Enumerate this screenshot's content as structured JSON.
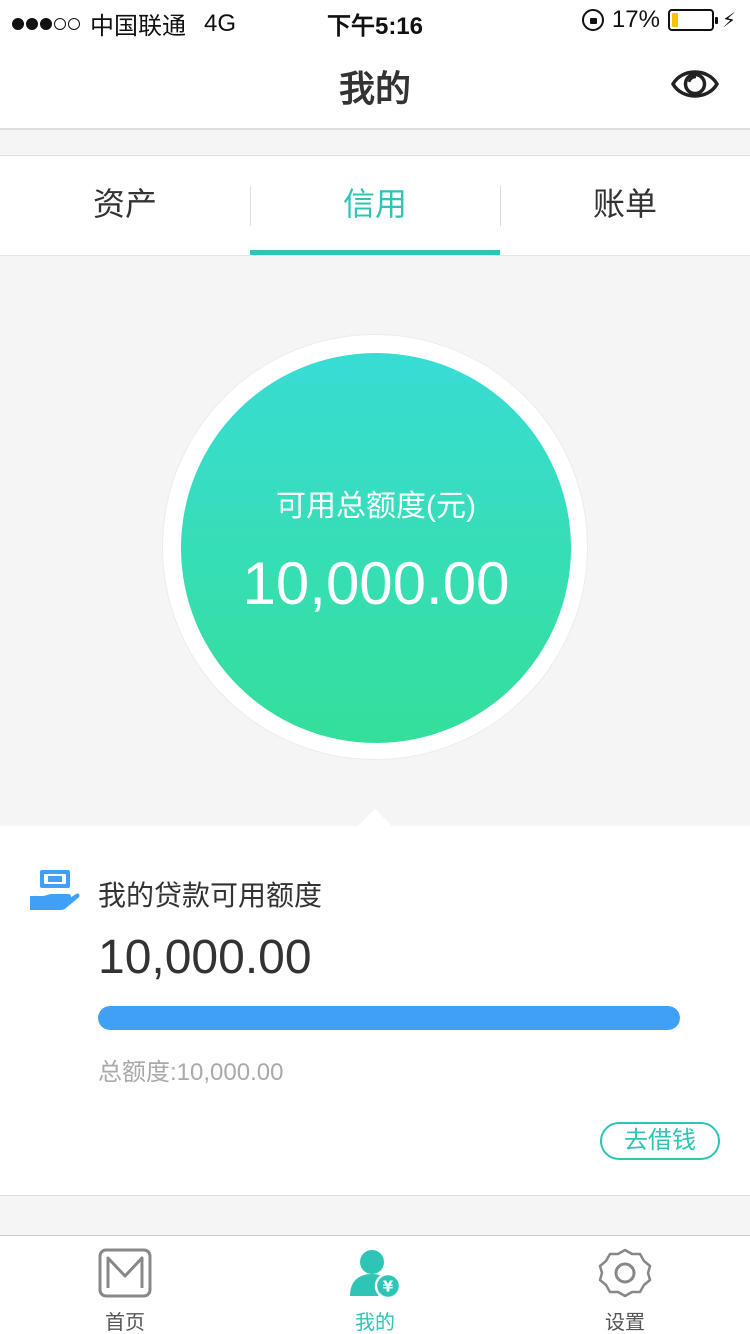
{
  "status_bar": {
    "carrier": "中国联通",
    "network": "4G",
    "time": "下午5:16",
    "battery": "17%",
    "battery_level": 0.17,
    "signal_bars": 3
  },
  "nav": {
    "title": "我的",
    "eye_icon": "eye-icon"
  },
  "tabs": [
    {
      "label": "资产",
      "active": false
    },
    {
      "label": "信用",
      "active": true
    },
    {
      "label": "账单",
      "active": false
    }
  ],
  "credit": {
    "label": "可用总额度(元)",
    "amount": "10,000.00"
  },
  "loan_card": {
    "icon": "loan-hand-icon",
    "title": "我的贷款可用额度",
    "amount": "10,000.00",
    "progress": 1.0,
    "total": "总额度:10,000.00",
    "button": "去借钱"
  },
  "tabbar": [
    {
      "label": "首页",
      "icon": "home-m-icon",
      "active": false
    },
    {
      "label": "我的",
      "icon": "user-yuan-icon",
      "active": true
    },
    {
      "label": "设置",
      "icon": "settings-gear-icon",
      "active": false
    }
  ],
  "colors": {
    "accent": "#2ec4b6",
    "circle_top": "#39dcd4",
    "circle_bottom": "#34df9a",
    "progress": "#3fa0f5",
    "battery": "#f5c400"
  }
}
